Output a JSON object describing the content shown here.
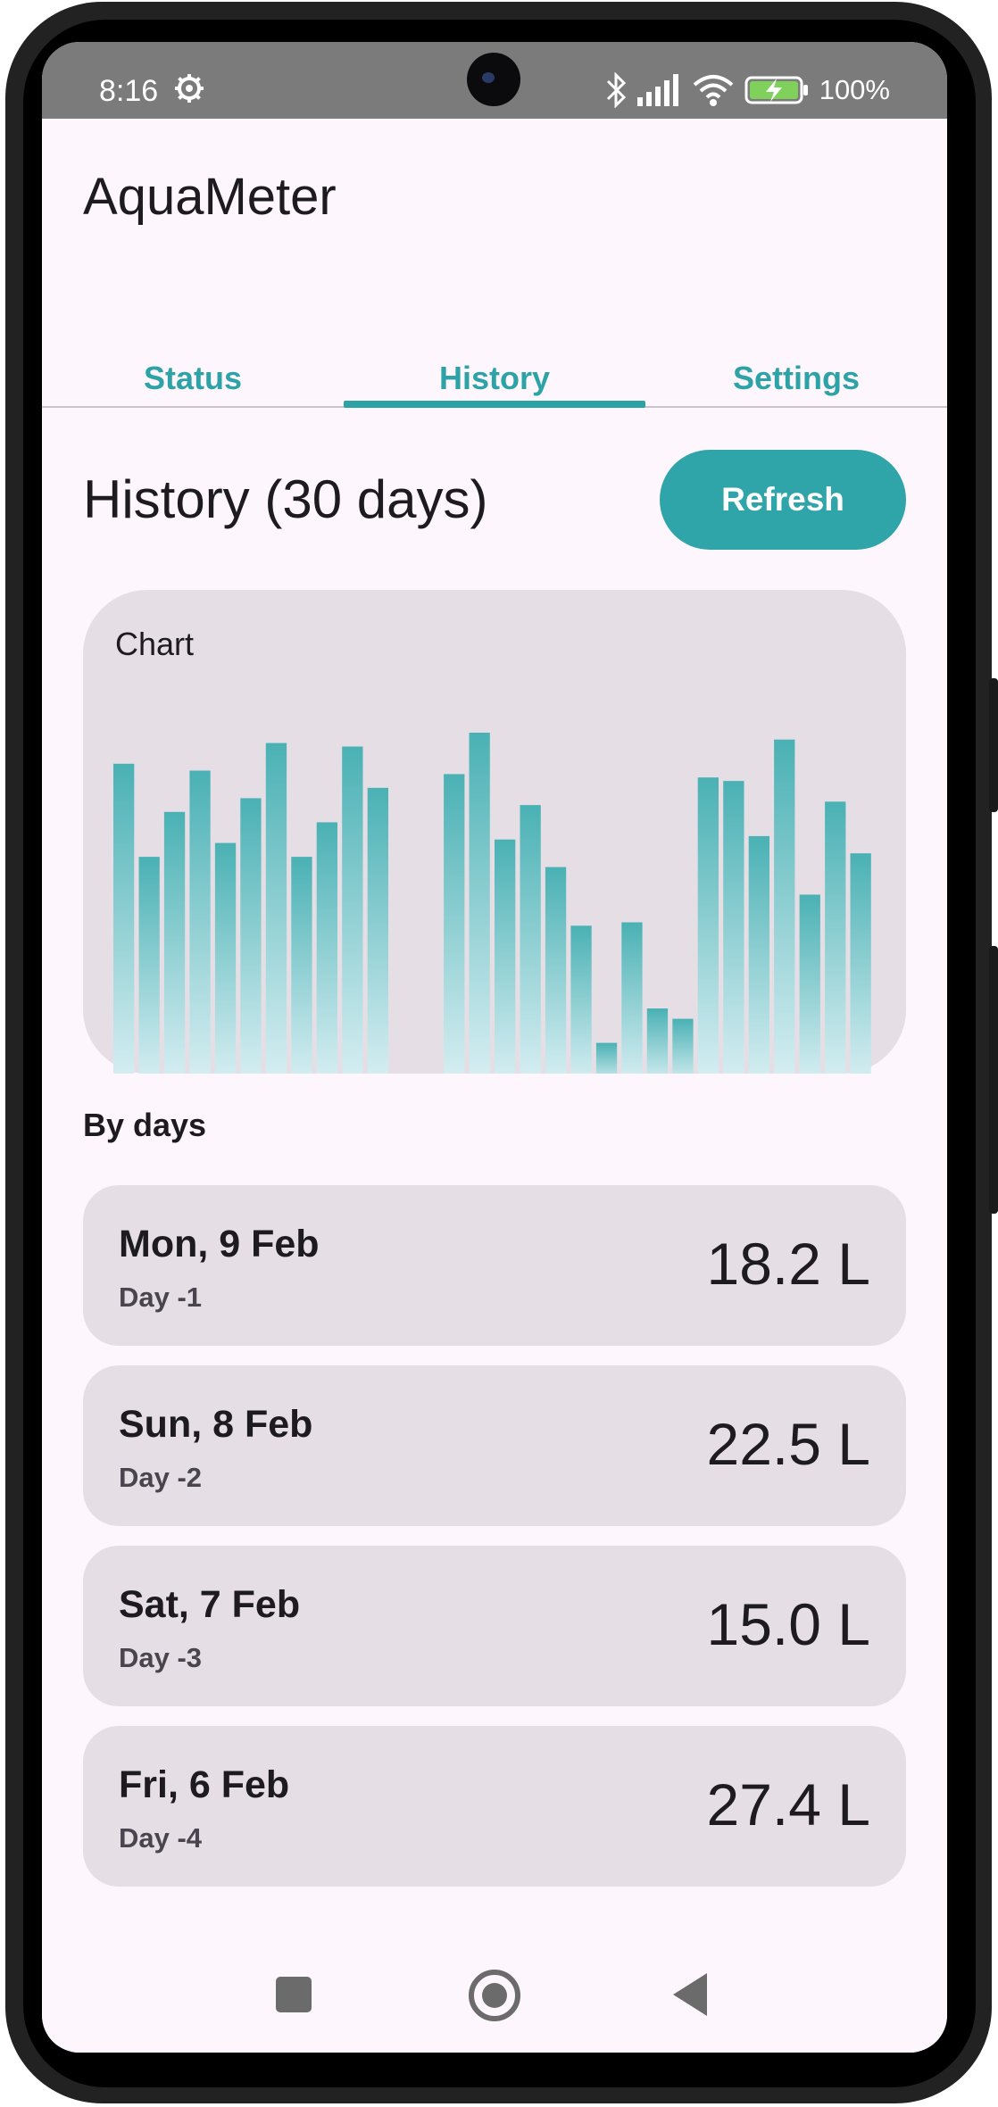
{
  "status_bar": {
    "time": "8:16",
    "battery": "100%"
  },
  "app": {
    "title": "AquaMeter"
  },
  "tabs": [
    {
      "label": "Status"
    },
    {
      "label": "History"
    },
    {
      "label": "Settings"
    }
  ],
  "active_tab": "History",
  "header": {
    "title": "History (30 days)",
    "refresh_label": "Refresh"
  },
  "chart_card": {
    "label": "Chart"
  },
  "chart_data": {
    "type": "bar",
    "title": "Chart",
    "values": [
      93,
      66,
      79,
      91,
      70,
      83,
      99,
      66,
      76,
      98,
      86,
      0,
      0,
      90,
      102,
      71,
      81,
      63,
      46,
      12,
      47,
      22,
      19,
      89,
      88,
      72,
      100,
      55,
      82,
      67
    ],
    "colors": {
      "bar_top": "#4ab1b4",
      "bar_bottom": "#d8eff3"
    }
  },
  "days_section": {
    "label": "By days"
  },
  "days": [
    {
      "name": "Mon, 9 Feb",
      "sub": "Day -1",
      "value": "18.2 L"
    },
    {
      "name": "Sun, 8 Feb",
      "sub": "Day -2",
      "value": "22.5 L"
    },
    {
      "name": "Sat, 7 Feb",
      "sub": "Day -3",
      "value": "15.0 L"
    },
    {
      "name": "Fri, 6 Feb",
      "sub": "Day -4",
      "value": "27.4 L"
    }
  ],
  "colors": {
    "accent": "#30a5a9",
    "background": "#fdf7fd",
    "card": "#e5dfe5"
  }
}
